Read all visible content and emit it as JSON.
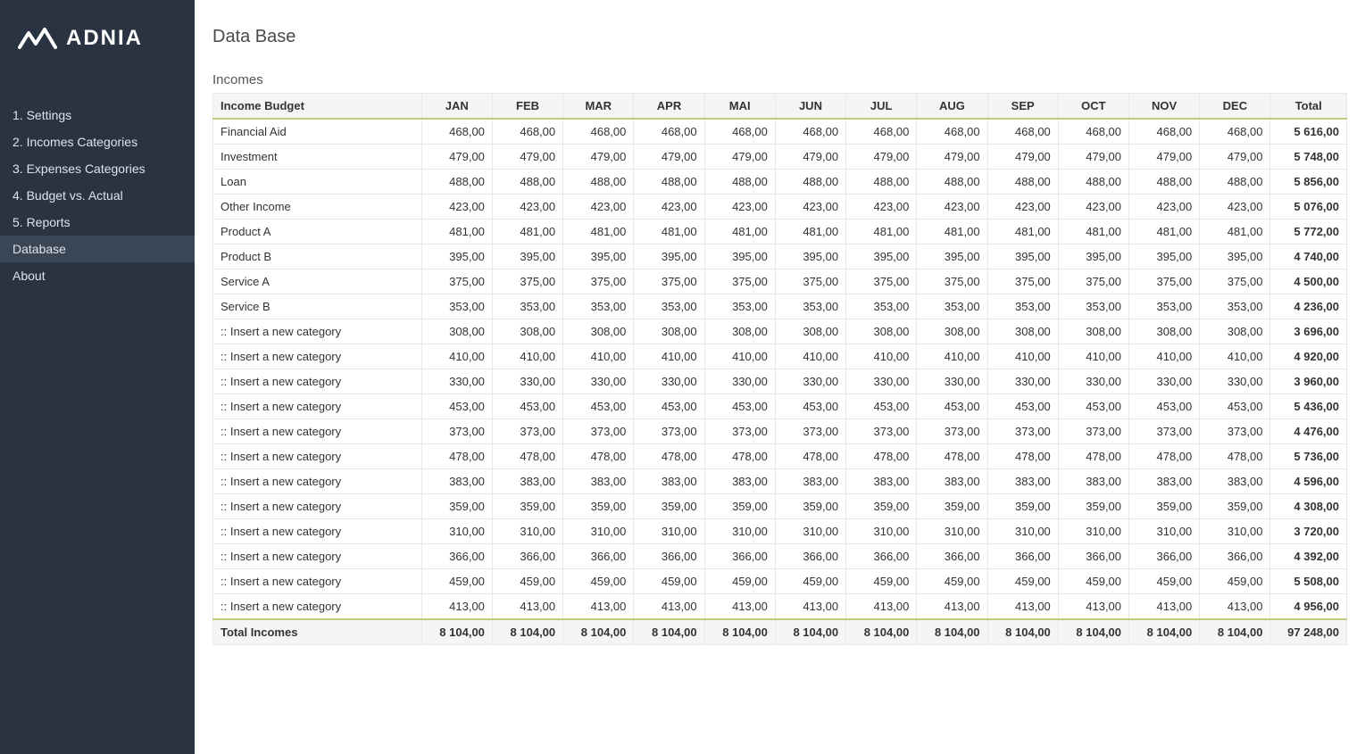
{
  "logo": {
    "text": "ADNIA"
  },
  "sidebar": {
    "items": [
      {
        "label": "1. Settings",
        "active": false
      },
      {
        "label": "2. Incomes Categories",
        "active": false
      },
      {
        "label": "3. Expenses Categories",
        "active": false
      },
      {
        "label": "4. Budget vs. Actual",
        "active": false
      },
      {
        "label": "5. Reports",
        "active": false
      },
      {
        "label": "Database",
        "active": true
      },
      {
        "label": "About",
        "active": false
      }
    ]
  },
  "page": {
    "title": "Data Base",
    "section_title": "Incomes"
  },
  "table": {
    "header_first": "Income Budget",
    "months": [
      "JAN",
      "FEB",
      "MAR",
      "APR",
      "MAI",
      "JUN",
      "JUL",
      "AUG",
      "SEP",
      "OCT",
      "NOV",
      "DEC"
    ],
    "header_total": "Total",
    "rows": [
      {
        "label": "Financial Aid",
        "values": [
          "468,00",
          "468,00",
          "468,00",
          "468,00",
          "468,00",
          "468,00",
          "468,00",
          "468,00",
          "468,00",
          "468,00",
          "468,00",
          "468,00"
        ],
        "total": "5 616,00"
      },
      {
        "label": "Investment",
        "values": [
          "479,00",
          "479,00",
          "479,00",
          "479,00",
          "479,00",
          "479,00",
          "479,00",
          "479,00",
          "479,00",
          "479,00",
          "479,00",
          "479,00"
        ],
        "total": "5 748,00"
      },
      {
        "label": "Loan",
        "values": [
          "488,00",
          "488,00",
          "488,00",
          "488,00",
          "488,00",
          "488,00",
          "488,00",
          "488,00",
          "488,00",
          "488,00",
          "488,00",
          "488,00"
        ],
        "total": "5 856,00"
      },
      {
        "label": "Other Income",
        "values": [
          "423,00",
          "423,00",
          "423,00",
          "423,00",
          "423,00",
          "423,00",
          "423,00",
          "423,00",
          "423,00",
          "423,00",
          "423,00",
          "423,00"
        ],
        "total": "5 076,00"
      },
      {
        "label": "Product A",
        "values": [
          "481,00",
          "481,00",
          "481,00",
          "481,00",
          "481,00",
          "481,00",
          "481,00",
          "481,00",
          "481,00",
          "481,00",
          "481,00",
          "481,00"
        ],
        "total": "5 772,00"
      },
      {
        "label": "Product B",
        "values": [
          "395,00",
          "395,00",
          "395,00",
          "395,00",
          "395,00",
          "395,00",
          "395,00",
          "395,00",
          "395,00",
          "395,00",
          "395,00",
          "395,00"
        ],
        "total": "4 740,00"
      },
      {
        "label": "Service A",
        "values": [
          "375,00",
          "375,00",
          "375,00",
          "375,00",
          "375,00",
          "375,00",
          "375,00",
          "375,00",
          "375,00",
          "375,00",
          "375,00",
          "375,00"
        ],
        "total": "4 500,00"
      },
      {
        "label": "Service B",
        "values": [
          "353,00",
          "353,00",
          "353,00",
          "353,00",
          "353,00",
          "353,00",
          "353,00",
          "353,00",
          "353,00",
          "353,00",
          "353,00",
          "353,00"
        ],
        "total": "4 236,00"
      },
      {
        "label": ":: Insert a new category",
        "values": [
          "308,00",
          "308,00",
          "308,00",
          "308,00",
          "308,00",
          "308,00",
          "308,00",
          "308,00",
          "308,00",
          "308,00",
          "308,00",
          "308,00"
        ],
        "total": "3 696,00"
      },
      {
        "label": ":: Insert a new category",
        "values": [
          "410,00",
          "410,00",
          "410,00",
          "410,00",
          "410,00",
          "410,00",
          "410,00",
          "410,00",
          "410,00",
          "410,00",
          "410,00",
          "410,00"
        ],
        "total": "4 920,00"
      },
      {
        "label": ":: Insert a new category",
        "values": [
          "330,00",
          "330,00",
          "330,00",
          "330,00",
          "330,00",
          "330,00",
          "330,00",
          "330,00",
          "330,00",
          "330,00",
          "330,00",
          "330,00"
        ],
        "total": "3 960,00"
      },
      {
        "label": ":: Insert a new category",
        "values": [
          "453,00",
          "453,00",
          "453,00",
          "453,00",
          "453,00",
          "453,00",
          "453,00",
          "453,00",
          "453,00",
          "453,00",
          "453,00",
          "453,00"
        ],
        "total": "5 436,00"
      },
      {
        "label": ":: Insert a new category",
        "values": [
          "373,00",
          "373,00",
          "373,00",
          "373,00",
          "373,00",
          "373,00",
          "373,00",
          "373,00",
          "373,00",
          "373,00",
          "373,00",
          "373,00"
        ],
        "total": "4 476,00"
      },
      {
        "label": ":: Insert a new category",
        "values": [
          "478,00",
          "478,00",
          "478,00",
          "478,00",
          "478,00",
          "478,00",
          "478,00",
          "478,00",
          "478,00",
          "478,00",
          "478,00",
          "478,00"
        ],
        "total": "5 736,00"
      },
      {
        "label": ":: Insert a new category",
        "values": [
          "383,00",
          "383,00",
          "383,00",
          "383,00",
          "383,00",
          "383,00",
          "383,00",
          "383,00",
          "383,00",
          "383,00",
          "383,00",
          "383,00"
        ],
        "total": "4 596,00"
      },
      {
        "label": ":: Insert a new category",
        "values": [
          "359,00",
          "359,00",
          "359,00",
          "359,00",
          "359,00",
          "359,00",
          "359,00",
          "359,00",
          "359,00",
          "359,00",
          "359,00",
          "359,00"
        ],
        "total": "4 308,00"
      },
      {
        "label": ":: Insert a new category",
        "values": [
          "310,00",
          "310,00",
          "310,00",
          "310,00",
          "310,00",
          "310,00",
          "310,00",
          "310,00",
          "310,00",
          "310,00",
          "310,00",
          "310,00"
        ],
        "total": "3 720,00"
      },
      {
        "label": ":: Insert a new category",
        "values": [
          "366,00",
          "366,00",
          "366,00",
          "366,00",
          "366,00",
          "366,00",
          "366,00",
          "366,00",
          "366,00",
          "366,00",
          "366,00",
          "366,00"
        ],
        "total": "4 392,00"
      },
      {
        "label": ":: Insert a new category",
        "values": [
          "459,00",
          "459,00",
          "459,00",
          "459,00",
          "459,00",
          "459,00",
          "459,00",
          "459,00",
          "459,00",
          "459,00",
          "459,00",
          "459,00"
        ],
        "total": "5 508,00"
      },
      {
        "label": ":: Insert a new category",
        "values": [
          "413,00",
          "413,00",
          "413,00",
          "413,00",
          "413,00",
          "413,00",
          "413,00",
          "413,00",
          "413,00",
          "413,00",
          "413,00",
          "413,00"
        ],
        "total": "4 956,00"
      }
    ],
    "footer": {
      "label": "Total Incomes",
      "values": [
        "8 104,00",
        "8 104,00",
        "8 104,00",
        "8 104,00",
        "8 104,00",
        "8 104,00",
        "8 104,00",
        "8 104,00",
        "8 104,00",
        "8 104,00",
        "8 104,00",
        "8 104,00"
      ],
      "total": "97 248,00"
    }
  }
}
